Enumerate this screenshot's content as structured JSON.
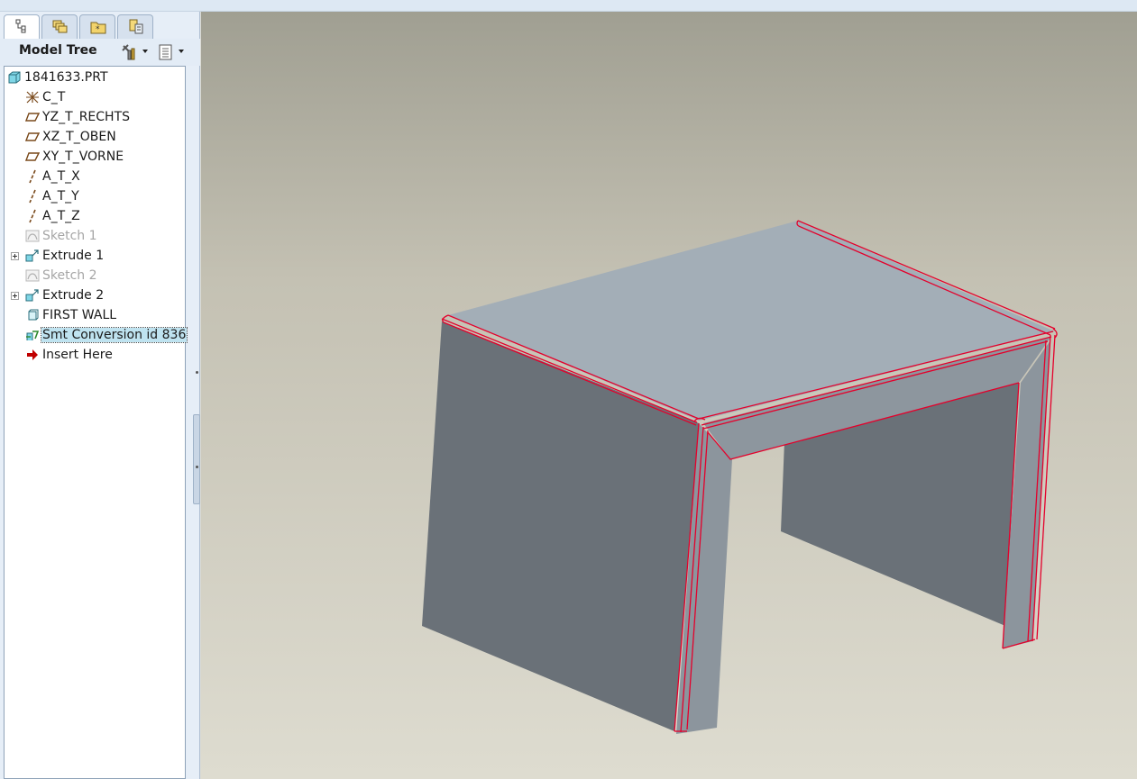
{
  "left_panel": {
    "tabs": [
      {
        "icon": "model-tree-icon",
        "active": true
      },
      {
        "icon": "layers-icon",
        "active": false
      },
      {
        "icon": "folder-icon",
        "active": false
      },
      {
        "icon": "favorites-icon",
        "active": false
      }
    ],
    "title": "Model Tree",
    "settings_icon": "tools-icon",
    "show_icon": "list-icon"
  },
  "model_tree": {
    "root": "1841633.PRT",
    "items": [
      {
        "label": "C_T",
        "icon": "coordinate-system-icon",
        "dim": false,
        "expandable": false,
        "selected": false
      },
      {
        "label": "YZ_T_RECHTS",
        "icon": "datum-plane-icon",
        "dim": false,
        "expandable": false,
        "selected": false
      },
      {
        "label": "XZ_T_OBEN",
        "icon": "datum-plane-icon",
        "dim": false,
        "expandable": false,
        "selected": false
      },
      {
        "label": "XY_T_VORNE",
        "icon": "datum-plane-icon",
        "dim": false,
        "expandable": false,
        "selected": false
      },
      {
        "label": "A_T_X",
        "icon": "datum-axis-icon",
        "dim": false,
        "expandable": false,
        "selected": false
      },
      {
        "label": "A_T_Y",
        "icon": "datum-axis-icon",
        "dim": false,
        "expandable": false,
        "selected": false
      },
      {
        "label": "A_T_Z",
        "icon": "datum-axis-icon",
        "dim": false,
        "expandable": false,
        "selected": false
      },
      {
        "label": "Sketch 1",
        "icon": "sketch-icon",
        "dim": true,
        "expandable": false,
        "selected": false
      },
      {
        "label": "Extrude 1",
        "icon": "extrude-icon",
        "dim": false,
        "expandable": true,
        "selected": false
      },
      {
        "label": "Sketch 2",
        "icon": "sketch-icon",
        "dim": true,
        "expandable": false,
        "selected": false
      },
      {
        "label": "Extrude 2",
        "icon": "extrude-icon",
        "dim": false,
        "expandable": true,
        "selected": false
      },
      {
        "label": "FIRST WALL",
        "icon": "wall-icon",
        "dim": false,
        "expandable": false,
        "selected": false
      },
      {
        "label": "Smt Conversion id 836",
        "icon": "conversion-icon",
        "dim": false,
        "expandable": false,
        "selected": true
      },
      {
        "label": "Insert Here",
        "icon": "insert-arrow-icon",
        "dim": false,
        "expandable": false,
        "selected": false
      }
    ]
  },
  "colors": {
    "edge_highlight": "#e4002b",
    "top_face": "#a3aeb7",
    "side_face": "#6a7178",
    "accent_selection": "#bfe3f0",
    "insert_arrow": "#c00000"
  }
}
